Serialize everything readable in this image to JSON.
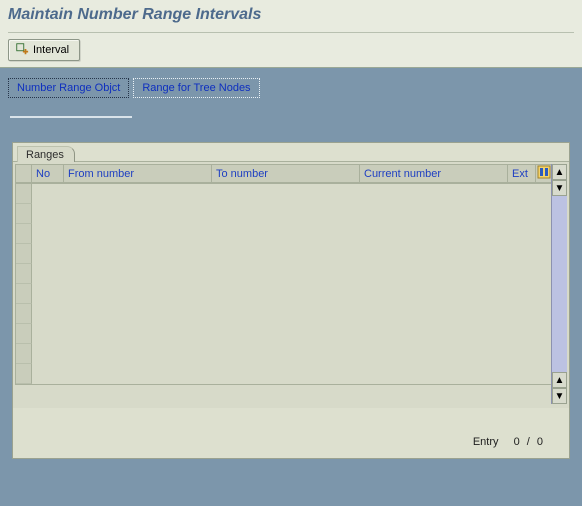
{
  "header": {
    "title": "Maintain Number Range Intervals",
    "interval_button_label": "Interval"
  },
  "tabs": {
    "active": "Number Range Objct",
    "items": [
      {
        "label": "Number Range Objct"
      },
      {
        "label": "Range for Tree Nodes"
      }
    ]
  },
  "panel": {
    "tab_label": "Ranges",
    "columns": {
      "selector": "",
      "no": "No",
      "from_number": "From number",
      "to_number": "To number",
      "current_number": "Current number",
      "ext": "Ext"
    },
    "rows": [],
    "visible_row_count": 10
  },
  "footer": {
    "entry_label": "Entry",
    "entry_current": "0",
    "entry_total": "0"
  }
}
